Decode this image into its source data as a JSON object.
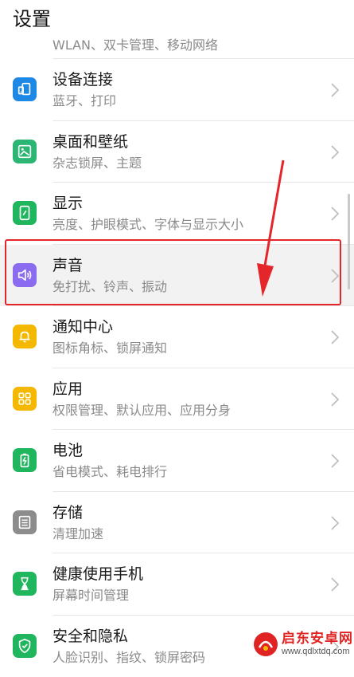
{
  "header": {
    "title": "设置"
  },
  "clipped_row": {
    "subtitle": "WLAN、双卡管理、移动网络"
  },
  "items": [
    {
      "id": "device-connection",
      "title": "设备连接",
      "subtitle": "蓝牙、打印",
      "icon": "device-connection-icon",
      "color": "#1e88e5"
    },
    {
      "id": "home-wallpaper",
      "title": "桌面和壁纸",
      "subtitle": "杂志锁屏、主题",
      "icon": "wallpaper-icon",
      "color": "#2bb673"
    },
    {
      "id": "display",
      "title": "显示",
      "subtitle": "亮度、护眼模式、字体与显示大小",
      "icon": "display-icon",
      "color": "#1fb65d"
    },
    {
      "id": "sound",
      "title": "声音",
      "subtitle": "免打扰、铃声、振动",
      "icon": "speaker-icon",
      "color": "#8b6cf0",
      "highlighted": true
    },
    {
      "id": "notification-center",
      "title": "通知中心",
      "subtitle": "图标角标、锁屏通知",
      "icon": "bell-icon",
      "color": "#f5b800"
    },
    {
      "id": "apps",
      "title": "应用",
      "subtitle": "权限管理、默认应用、应用分身",
      "icon": "apps-grid-icon",
      "color": "#f5b800"
    },
    {
      "id": "battery",
      "title": "电池",
      "subtitle": "省电模式、耗电排行",
      "icon": "battery-icon",
      "color": "#1fb65d"
    },
    {
      "id": "storage",
      "title": "存储",
      "subtitle": "清理加速",
      "icon": "storage-icon",
      "color": "#8c8c8c"
    },
    {
      "id": "digital-balance",
      "title": "健康使用手机",
      "subtitle": "屏幕时间管理",
      "icon": "hourglass-icon",
      "color": "#1fb65d"
    },
    {
      "id": "security-privacy",
      "title": "安全和隐私",
      "subtitle": "人脸识别、指纹、锁屏密码",
      "icon": "shield-icon",
      "color": "#1fb65d"
    }
  ],
  "annotation": {
    "box_color": "#e4262b",
    "arrow_color": "#e4262b"
  },
  "watermark": {
    "title": "启东安卓网",
    "url": "www.qdlxtdq.com"
  }
}
